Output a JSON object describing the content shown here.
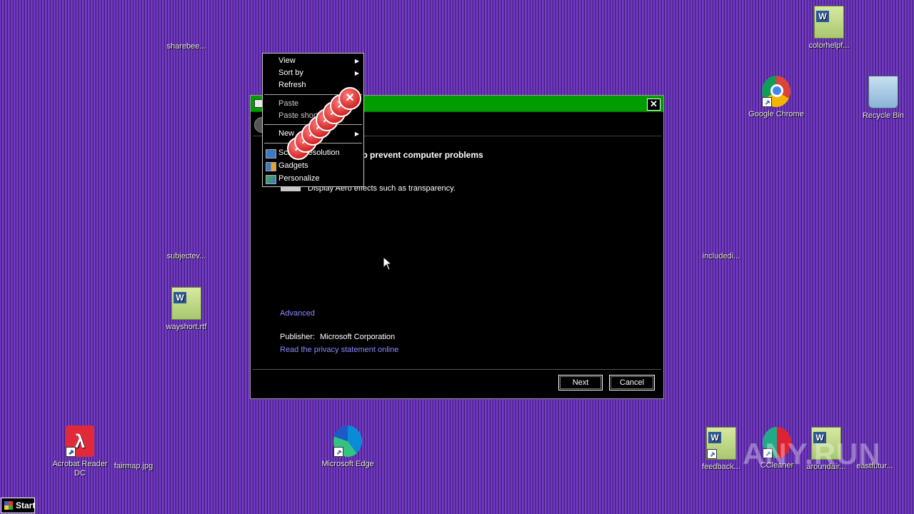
{
  "desktop": {
    "icons": [
      {
        "label": "sharebee..."
      },
      {
        "label": "subjectev..."
      },
      {
        "label": "wayshort.rtf"
      },
      {
        "label": "Acrobat Reader DC"
      },
      {
        "label": "fairmap.jpg"
      },
      {
        "label": "Microsoft Edge"
      },
      {
        "label": "colorhelpf..."
      },
      {
        "label": "Google Chrome"
      },
      {
        "label": "Recycle Bin"
      },
      {
        "label": "includedi..."
      },
      {
        "label": "feedback..."
      },
      {
        "label": "CCleaner"
      },
      {
        "label": "aroundair..."
      },
      {
        "label": "eastfutur..."
      }
    ]
  },
  "dialog": {
    "heading": "lp prevent computer problems",
    "option_text": "Display Aero effects such as transparency.",
    "advanced_link": "Advanced",
    "publisher_label": "Publisher:",
    "publisher_value": "Microsoft Corporation",
    "privacy_link": "Read the privacy statement online",
    "next_label": "Next",
    "cancel_label": "Cancel",
    "close_glyph": "✕"
  },
  "context_menu": {
    "items": [
      {
        "label": "View",
        "submenu": true
      },
      {
        "label": "Sort by",
        "submenu": true
      },
      {
        "label": "Refresh"
      },
      {
        "label": "Paste"
      },
      {
        "label": "Paste shortcut"
      },
      {
        "label": "New",
        "submenu": true
      },
      {
        "label": "Screen resolution"
      },
      {
        "label": "Gadgets"
      },
      {
        "label": "Personalize"
      }
    ]
  },
  "taskbar": {
    "start_label": "Start"
  },
  "watermark": "ANY.RUN",
  "colors": {
    "titlebar": "#009c00",
    "link": "#8c8cff"
  }
}
